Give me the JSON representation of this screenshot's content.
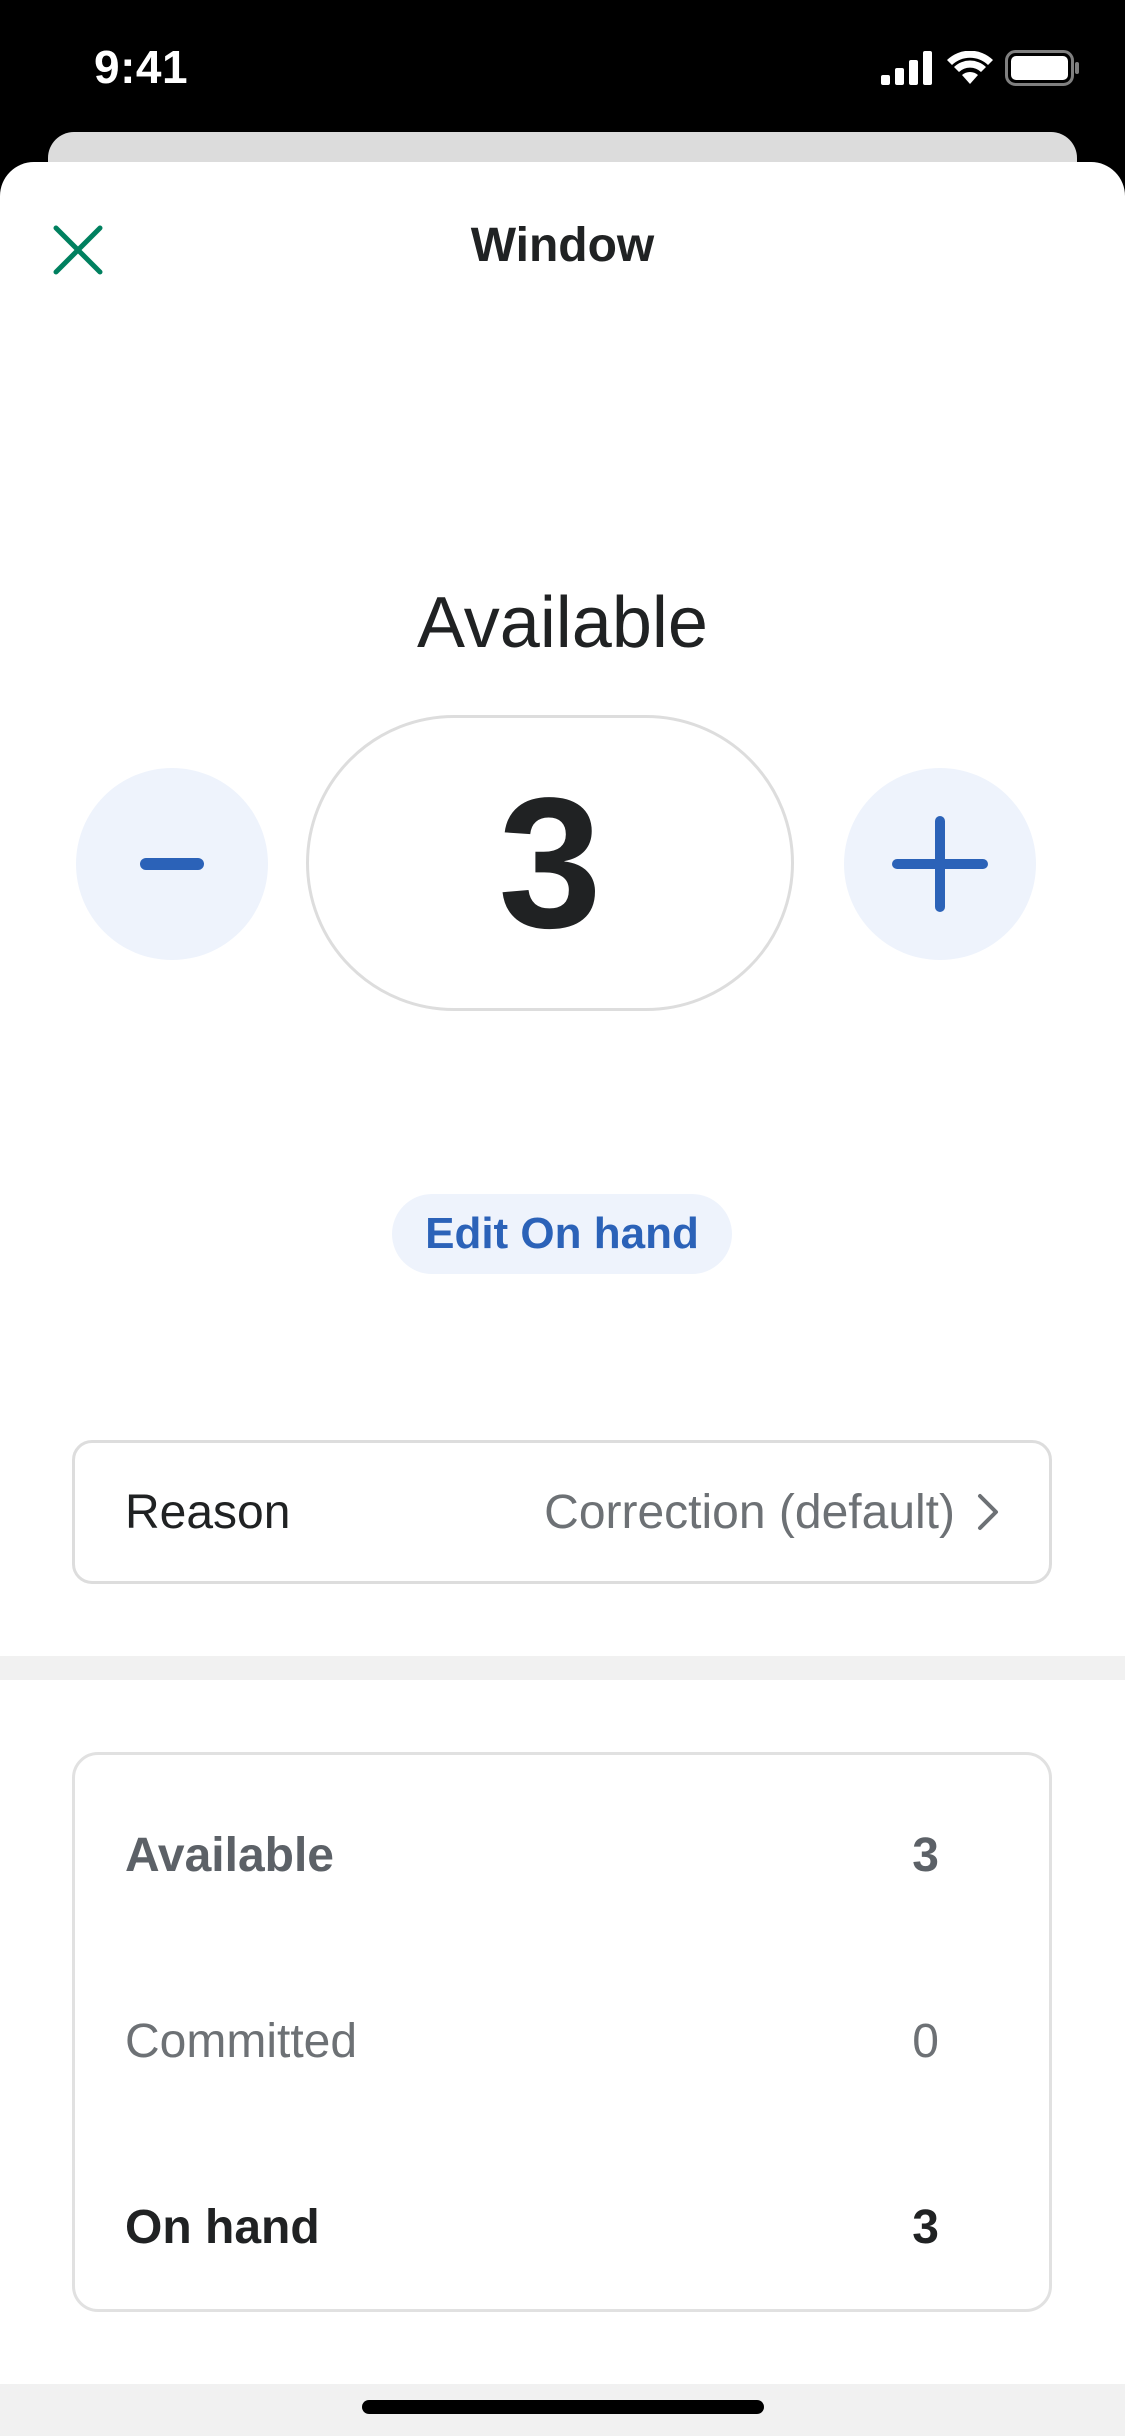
{
  "status_bar": {
    "time": "9:41"
  },
  "header": {
    "title": "Window",
    "close_icon": "close-icon"
  },
  "quantity": {
    "label": "Available",
    "value": "3",
    "decrement_icon": "minus-icon",
    "increment_icon": "plus-icon"
  },
  "edit_button": {
    "label": "Edit On hand"
  },
  "reason": {
    "label": "Reason",
    "value": "Correction (default)",
    "chevron_icon": "chevron-right-icon"
  },
  "summary": {
    "rows": [
      {
        "label": "Available",
        "value": "3"
      },
      {
        "label": "Committed",
        "value": "0"
      },
      {
        "label": "On hand",
        "value": "3"
      }
    ]
  },
  "colors": {
    "accent_green": "#00805f",
    "accent_blue": "#2b62b8",
    "stepper_bg": "#eef3fc"
  }
}
